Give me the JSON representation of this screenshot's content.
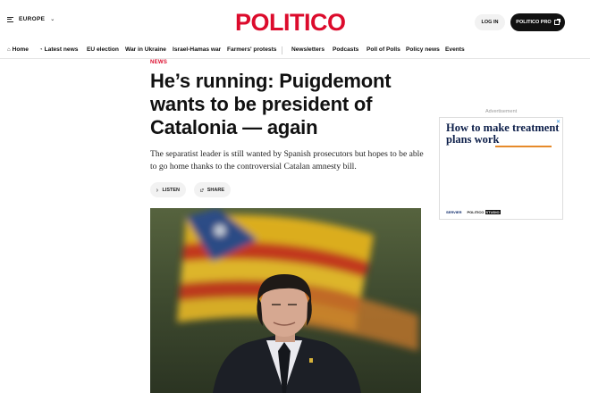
{
  "header": {
    "edition": "EUROPE",
    "logo": "POLITICO",
    "login_label": "LOG IN",
    "pro_label": "POLITICO PRO"
  },
  "nav": {
    "items": [
      "Home",
      "Latest news",
      "EU election",
      "War in Ukraine",
      "Israel-Hamas war",
      "Farmers' protests",
      "Newsletters",
      "Podcasts",
      "Poll of Polls",
      "Policy news",
      "Events"
    ]
  },
  "article": {
    "kicker": "NEWS",
    "headline": "He’s running: Puigdemont wants to be president of Catalonia — again",
    "dek": "The separatist leader is still wanted by Spanish prosecutors but hopes to be able to go home thanks to the controversial Catalan amnesty bill.",
    "listen_label": "LISTEN",
    "share_label": "SHARE"
  },
  "ad": {
    "label": "Advertisement",
    "title": "How to make treatment plans work",
    "brand_left": "SERVIER",
    "brand_right": "POLITICO",
    "brand_right_badge": "STUDIO",
    "close": "✕"
  },
  "colors": {
    "brand_red": "#dc0b2c",
    "ad_navy": "#0d1f4a",
    "ad_orange": "#e68a2a"
  },
  "icons": [
    "menu-icon",
    "chevron-down-icon",
    "home-icon",
    "clock-icon",
    "play-icon",
    "share-icon",
    "external-link-icon",
    "close-icon"
  ]
}
